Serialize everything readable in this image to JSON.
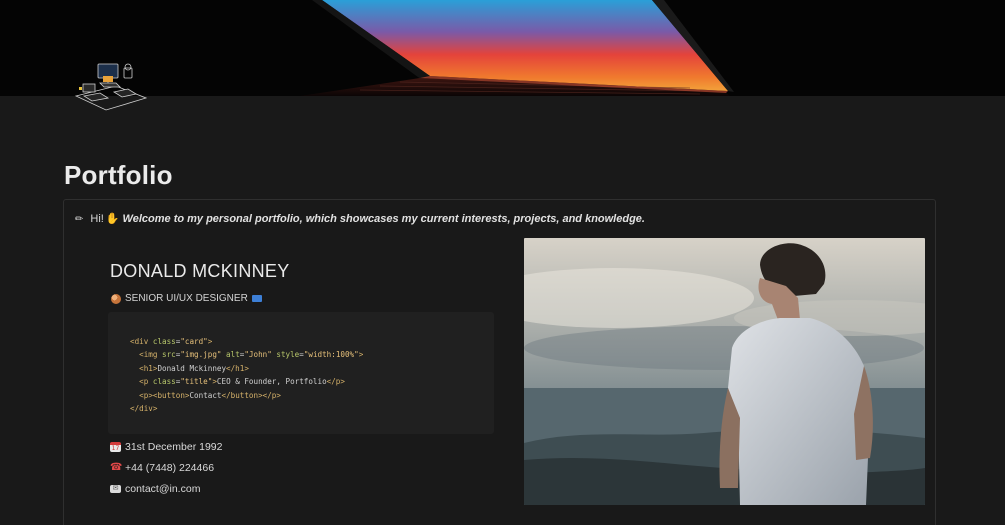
{
  "cover": {
    "image": "laptop-sunset-cover",
    "colors": {
      "sky_top": "#2a9fd8",
      "sky_mid": "#e4433b",
      "sky_bottom": "#f2a23a"
    }
  },
  "page": {
    "icon": "workspace-desk-icon",
    "title": "Portfolio"
  },
  "callout": {
    "icon": "pencil-icon",
    "greeting": "Hi!",
    "greeting_icon": "waving-hand-icon",
    "message": "Welcome to my personal portfolio, which showcases my current interests, projects, and knowledge."
  },
  "profile": {
    "name": "DONALD MCKINNEY",
    "role_icon": "palette-icon",
    "role": "SENIOR UI/UX DESIGNER",
    "role_suffix_icon": "laptop-icon"
  },
  "code": {
    "lines": [
      {
        "indent": 0,
        "text": "<div class=\"card\">"
      },
      {
        "indent": 1,
        "text": "<img src=\"img.jpg\" alt=\"John\" style=\"width:100%\">"
      },
      {
        "indent": 1,
        "text": "<h1>Donald Mckinney</h1>"
      },
      {
        "indent": 1,
        "text": "<p class=\"title\">CEO & Founder, Portfolio</p>"
      },
      {
        "indent": 1,
        "text": "<p><button>Contact</button></p>"
      },
      {
        "indent": 0,
        "text": "</div>"
      }
    ]
  },
  "contact": {
    "birthday_icon": "calendar-icon",
    "birthday": "31st December 1992",
    "phone_icon": "telephone-icon",
    "phone": "+44 (7448) 224466",
    "email_icon": "envelope-icon",
    "email": "contact@in.com"
  },
  "photo": {
    "image": "man-on-mountain-photo"
  }
}
